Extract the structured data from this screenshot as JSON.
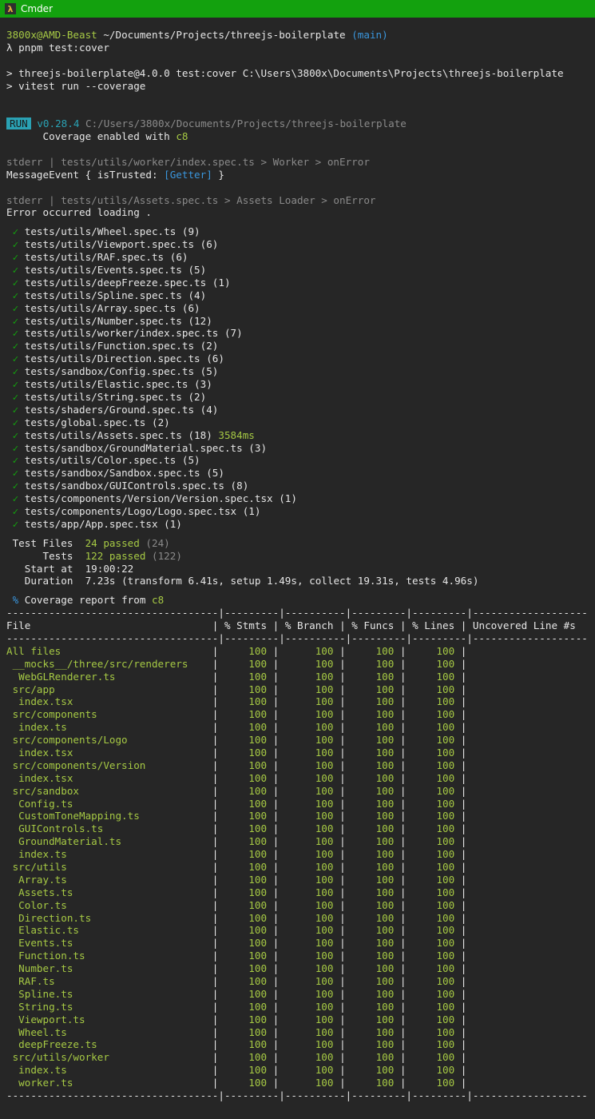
{
  "window": {
    "title": "Cmder",
    "icon": "lambda-icon"
  },
  "prompt": {
    "user_host": "3800x@AMD-Beast",
    "path": "~/Documents/Projects/threejs-boilerplate",
    "branch": "(main)",
    "command": "λ pnpm test:cover"
  },
  "script_lines": [
    "> threejs-boilerplate@4.0.0 test:cover C:\\Users\\3800x\\Documents\\Projects\\threejs-boilerplate",
    "> vitest run --coverage"
  ],
  "run": {
    "badge": "RUN",
    "version": "v0.28.4",
    "path": "C:/Users/3800x/Documents/Projects/threejs-boilerplate",
    "coverage_prefix": "Coverage enabled with",
    "coverage_tool": "c8"
  },
  "stderr": [
    {
      "label": "stderr | tests/utils/worker/index.spec.ts > Worker > onError",
      "pre": "MessageEvent { isTrusted: ",
      "getter": "[Getter]",
      "post": " }"
    },
    {
      "label": "stderr | tests/utils/Assets.spec.ts > Assets Loader > onError",
      "pre": "Error occurred loading .",
      "getter": "",
      "post": ""
    }
  ],
  "tests": [
    {
      "name": "tests/utils/Wheel.spec.ts",
      "count": "(9)",
      "time": ""
    },
    {
      "name": "tests/utils/Viewport.spec.ts",
      "count": "(6)",
      "time": ""
    },
    {
      "name": "tests/utils/RAF.spec.ts",
      "count": "(6)",
      "time": ""
    },
    {
      "name": "tests/utils/Events.spec.ts",
      "count": "(5)",
      "time": ""
    },
    {
      "name": "tests/utils/deepFreeze.spec.ts",
      "count": "(1)",
      "time": ""
    },
    {
      "name": "tests/utils/Spline.spec.ts",
      "count": "(4)",
      "time": ""
    },
    {
      "name": "tests/utils/Array.spec.ts",
      "count": "(6)",
      "time": ""
    },
    {
      "name": "tests/utils/Number.spec.ts",
      "count": "(12)",
      "time": ""
    },
    {
      "name": "tests/utils/worker/index.spec.ts",
      "count": "(7)",
      "time": ""
    },
    {
      "name": "tests/utils/Function.spec.ts",
      "count": "(2)",
      "time": ""
    },
    {
      "name": "tests/utils/Direction.spec.ts",
      "count": "(6)",
      "time": ""
    },
    {
      "name": "tests/sandbox/Config.spec.ts",
      "count": "(5)",
      "time": ""
    },
    {
      "name": "tests/utils/Elastic.spec.ts",
      "count": "(3)",
      "time": ""
    },
    {
      "name": "tests/utils/String.spec.ts",
      "count": "(2)",
      "time": ""
    },
    {
      "name": "tests/shaders/Ground.spec.ts",
      "count": "(4)",
      "time": ""
    },
    {
      "name": "tests/global.spec.ts",
      "count": "(2)",
      "time": ""
    },
    {
      "name": "tests/utils/Assets.spec.ts",
      "count": "(18)",
      "time": "3584ms"
    },
    {
      "name": "tests/sandbox/GroundMaterial.spec.ts",
      "count": "(3)",
      "time": ""
    },
    {
      "name": "tests/utils/Color.spec.ts",
      "count": "(5)",
      "time": ""
    },
    {
      "name": "tests/sandbox/Sandbox.spec.ts",
      "count": "(5)",
      "time": ""
    },
    {
      "name": "tests/sandbox/GUIControls.spec.ts",
      "count": "(8)",
      "time": ""
    },
    {
      "name": "tests/components/Version/Version.spec.tsx",
      "count": "(1)",
      "time": ""
    },
    {
      "name": "tests/components/Logo/Logo.spec.tsx",
      "count": "(1)",
      "time": ""
    },
    {
      "name": "tests/app/App.spec.tsx",
      "count": "(1)",
      "time": ""
    }
  ],
  "check_glyph": "✓",
  "summary": {
    "test_files_label": " Test Files  ",
    "test_files_value": "24 passed",
    "test_files_total": " (24)",
    "tests_label": "      Tests  ",
    "tests_value": "122 passed",
    "tests_total": " (122)",
    "start_label": "   Start at  ",
    "start_value": "19:00:22",
    "duration_label": "   Duration  ",
    "duration_value": "7.23s (transform 6.41s, setup 1.49s, collect 19.31s, tests 4.96s)"
  },
  "coverage": {
    "header_pct": "%",
    "header_text": " Coverage report from ",
    "tool": "c8",
    "separator": "-----------------------------------|---------|----------|---------|---------|-------------------",
    "columns": [
      "File",
      "% Stmts",
      "% Branch",
      "% Funcs",
      "% Lines",
      "Uncovered Line #s"
    ],
    "rows": [
      {
        "file": "All files",
        "indent": 0,
        "v": [
          "100",
          "100",
          "100",
          "100",
          ""
        ]
      },
      {
        "file": "__mocks__/three/src/renderers",
        "indent": 1,
        "v": [
          "100",
          "100",
          "100",
          "100",
          ""
        ]
      },
      {
        "file": "WebGLRenderer.ts",
        "indent": 2,
        "v": [
          "100",
          "100",
          "100",
          "100",
          ""
        ]
      },
      {
        "file": "src/app",
        "indent": 1,
        "v": [
          "100",
          "100",
          "100",
          "100",
          ""
        ]
      },
      {
        "file": "index.tsx",
        "indent": 2,
        "v": [
          "100",
          "100",
          "100",
          "100",
          ""
        ]
      },
      {
        "file": "src/components",
        "indent": 1,
        "v": [
          "100",
          "100",
          "100",
          "100",
          ""
        ]
      },
      {
        "file": "index.ts",
        "indent": 2,
        "v": [
          "100",
          "100",
          "100",
          "100",
          ""
        ]
      },
      {
        "file": "src/components/Logo",
        "indent": 1,
        "v": [
          "100",
          "100",
          "100",
          "100",
          ""
        ]
      },
      {
        "file": "index.tsx",
        "indent": 2,
        "v": [
          "100",
          "100",
          "100",
          "100",
          ""
        ]
      },
      {
        "file": "src/components/Version",
        "indent": 1,
        "v": [
          "100",
          "100",
          "100",
          "100",
          ""
        ]
      },
      {
        "file": "index.tsx",
        "indent": 2,
        "v": [
          "100",
          "100",
          "100",
          "100",
          ""
        ]
      },
      {
        "file": "src/sandbox",
        "indent": 1,
        "v": [
          "100",
          "100",
          "100",
          "100",
          ""
        ]
      },
      {
        "file": "Config.ts",
        "indent": 2,
        "v": [
          "100",
          "100",
          "100",
          "100",
          ""
        ]
      },
      {
        "file": "CustomToneMapping.ts",
        "indent": 2,
        "v": [
          "100",
          "100",
          "100",
          "100",
          ""
        ]
      },
      {
        "file": "GUIControls.ts",
        "indent": 2,
        "v": [
          "100",
          "100",
          "100",
          "100",
          ""
        ]
      },
      {
        "file": "GroundMaterial.ts",
        "indent": 2,
        "v": [
          "100",
          "100",
          "100",
          "100",
          ""
        ]
      },
      {
        "file": "index.ts",
        "indent": 2,
        "v": [
          "100",
          "100",
          "100",
          "100",
          ""
        ]
      },
      {
        "file": "src/utils",
        "indent": 1,
        "v": [
          "100",
          "100",
          "100",
          "100",
          ""
        ]
      },
      {
        "file": "Array.ts",
        "indent": 2,
        "v": [
          "100",
          "100",
          "100",
          "100",
          ""
        ]
      },
      {
        "file": "Assets.ts",
        "indent": 2,
        "v": [
          "100",
          "100",
          "100",
          "100",
          ""
        ]
      },
      {
        "file": "Color.ts",
        "indent": 2,
        "v": [
          "100",
          "100",
          "100",
          "100",
          ""
        ]
      },
      {
        "file": "Direction.ts",
        "indent": 2,
        "v": [
          "100",
          "100",
          "100",
          "100",
          ""
        ]
      },
      {
        "file": "Elastic.ts",
        "indent": 2,
        "v": [
          "100",
          "100",
          "100",
          "100",
          ""
        ]
      },
      {
        "file": "Events.ts",
        "indent": 2,
        "v": [
          "100",
          "100",
          "100",
          "100",
          ""
        ]
      },
      {
        "file": "Function.ts",
        "indent": 2,
        "v": [
          "100",
          "100",
          "100",
          "100",
          ""
        ]
      },
      {
        "file": "Number.ts",
        "indent": 2,
        "v": [
          "100",
          "100",
          "100",
          "100",
          ""
        ]
      },
      {
        "file": "RAF.ts",
        "indent": 2,
        "v": [
          "100",
          "100",
          "100",
          "100",
          ""
        ]
      },
      {
        "file": "Spline.ts",
        "indent": 2,
        "v": [
          "100",
          "100",
          "100",
          "100",
          ""
        ]
      },
      {
        "file": "String.ts",
        "indent": 2,
        "v": [
          "100",
          "100",
          "100",
          "100",
          ""
        ]
      },
      {
        "file": "Viewport.ts",
        "indent": 2,
        "v": [
          "100",
          "100",
          "100",
          "100",
          ""
        ]
      },
      {
        "file": "Wheel.ts",
        "indent": 2,
        "v": [
          "100",
          "100",
          "100",
          "100",
          ""
        ]
      },
      {
        "file": "deepFreeze.ts",
        "indent": 2,
        "v": [
          "100",
          "100",
          "100",
          "100",
          ""
        ]
      },
      {
        "file": "src/utils/worker",
        "indent": 1,
        "v": [
          "100",
          "100",
          "100",
          "100",
          ""
        ]
      },
      {
        "file": "index.ts",
        "indent": 2,
        "v": [
          "100",
          "100",
          "100",
          "100",
          ""
        ]
      },
      {
        "file": "worker.ts",
        "indent": 2,
        "v": [
          "100",
          "100",
          "100",
          "100",
          ""
        ]
      }
    ]
  }
}
